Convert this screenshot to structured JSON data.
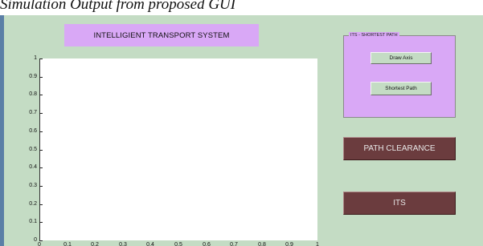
{
  "caption": "Simulation Output from proposed GUI",
  "header": {
    "title": "INTELLIGIENT TRANSPORT SYSTEM"
  },
  "axes": {
    "yticks": [
      "0",
      "0.1",
      "0.2",
      "0.3",
      "0.4",
      "0.5",
      "0.6",
      "0.7",
      "0.8",
      "0.9",
      "1"
    ],
    "xticks": [
      "0",
      "0.1",
      "0.2",
      "0.3",
      "0.4",
      "0.5",
      "0.6",
      "0.7",
      "0.8",
      "0.9",
      "1"
    ]
  },
  "panel": {
    "title": "ITS - SHORTEST PATH",
    "draw_axis_label": "Draw Axis",
    "shortest_path_label": "Shortest Path"
  },
  "buttons": {
    "path_clearance_label": "PATH CLEARANCE",
    "its_label": "ITS"
  },
  "colors": {
    "figure_background": "#c4dcc4",
    "purple_panel": "#d9a8f6",
    "maroon_button": "#6b3c3e"
  }
}
